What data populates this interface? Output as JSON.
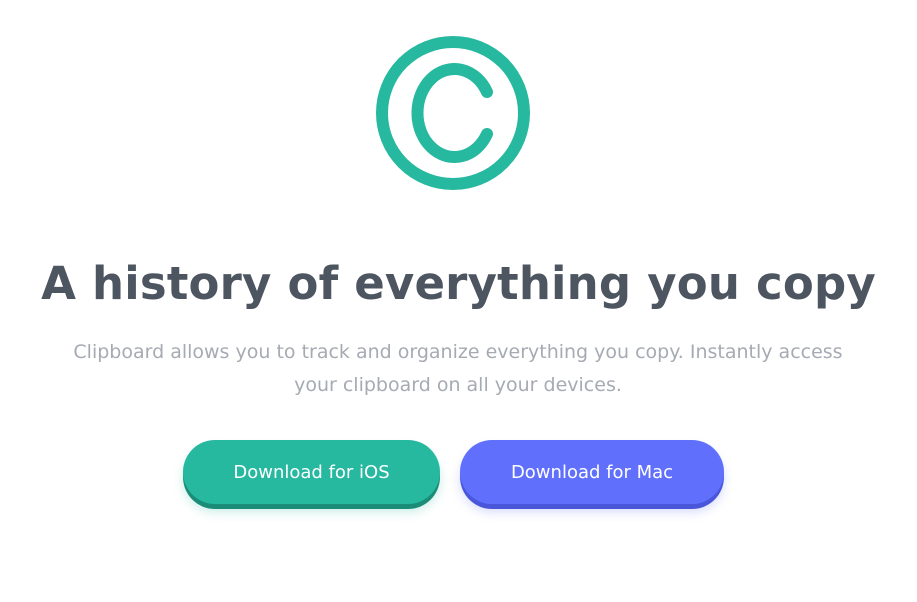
{
  "brand": {
    "logo_icon": "copyright-circle-icon",
    "accent_color": "#26b9a0"
  },
  "hero": {
    "headline": "A history of everything you copy",
    "subtitle": "Clipboard allows you to track and organize everything you copy. Instantly access your clipboard on all your devices."
  },
  "actions": {
    "ios_label": "Download for iOS",
    "ios_color": "#26b9a0",
    "mac_label": "Download for Mac",
    "mac_color": "#6070fd"
  }
}
